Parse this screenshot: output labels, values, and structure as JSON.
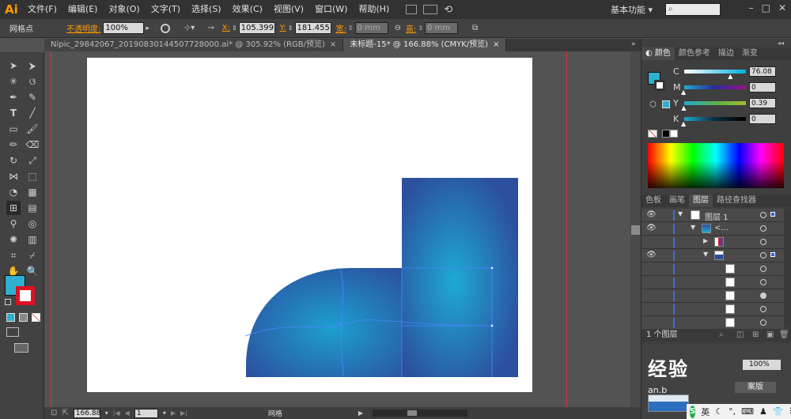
{
  "app": {
    "logo": "Ai",
    "workspace": "基本功能",
    "search_placeholder": ""
  },
  "menu": [
    "文件(F)",
    "编辑(E)",
    "对象(O)",
    "文字(T)",
    "选择(S)",
    "效果(C)",
    "视图(V)",
    "窗口(W)",
    "帮助(H)"
  ],
  "window_controls": [
    "–",
    "□",
    "✕"
  ],
  "controlbar": {
    "tool_name": "网格点",
    "opacity_label": "不透明度:",
    "opacity_value": "100%",
    "x_label": "X:",
    "x_value": "105.399",
    "y_label": "Y:",
    "y_value": "181.455",
    "w_label": "宽:",
    "w_value": "0 mm",
    "h_label": "高:",
    "h_value": "0 mm"
  },
  "tabs": [
    {
      "label": "Nipic_29842067_20190830144507728000.ai* @ 305.92% (RGB/预览)",
      "close": "×",
      "active": false
    },
    {
      "label": "未标题-15* @ 166.88% (CMYK/预览)",
      "close": "×",
      "active": true
    }
  ],
  "statusbar": {
    "zoom": "166.88",
    "page": "1",
    "tool_label": "网格"
  },
  "color_panel": {
    "tabs": [
      "颜色",
      "颜色参考",
      "描边",
      "渐变"
    ],
    "channels": [
      {
        "label": "C",
        "value": "76.08",
        "level": 0.76
      },
      {
        "label": "M",
        "value": "0",
        "level": 0
      },
      {
        "label": "Y",
        "value": "0.39",
        "level": 0.004
      },
      {
        "label": "K",
        "value": "0",
        "level": 0
      }
    ]
  },
  "layers_panel": {
    "tabs": [
      "色板",
      "画笔",
      "图层",
      "路径查找器"
    ],
    "layer_name": "图层 1",
    "sublayer_name": "<...",
    "footer": "1 个图层"
  },
  "bottom_panel": {
    "button_label": "案版",
    "percent": "100%",
    "watermark": "经验",
    "watermark_url": "an.b"
  },
  "taskbar": {
    "ime": "英"
  },
  "colors": {
    "fill_swatch": "#2fb0d0",
    "shape_dark": "#2c4f9e",
    "shape_light": "#1ea6d2"
  }
}
